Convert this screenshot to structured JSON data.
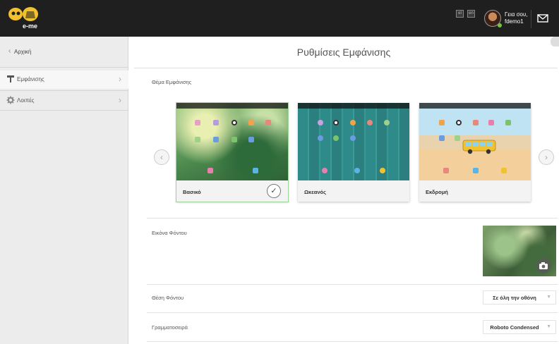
{
  "header": {
    "logo_text": "e-me",
    "greeting_line1": "Γεια σου,",
    "greeting_line2": "fdemo1",
    "square_icons": [
      "el",
      "en"
    ]
  },
  "sidebar": {
    "back_label": "Αρχική",
    "items": [
      {
        "label": "Εμφάνισης",
        "icon": "paint-roller-icon",
        "active": true
      },
      {
        "label": "Λοιπές",
        "icon": "gear-icon",
        "active": false
      }
    ]
  },
  "main": {
    "title": "Ρυθμίσεις Εμφάνισης",
    "theme_section_label": "Θέμα Εμφάνισης",
    "themes": [
      {
        "name": "Βασικό",
        "selected": true
      },
      {
        "name": "Ωκεανός",
        "selected": false
      },
      {
        "name": "Εκδρομή",
        "selected": false
      }
    ],
    "background_image_label": "Εικόνα Φόντου",
    "background_position_label": "Θέση Φόντου",
    "background_position_value": "Σε όλη την οθόνη",
    "font_label": "Γραμματοσειρά",
    "font_value": "Roboto Condensed"
  },
  "colors": {
    "topbar": "#1f1f1f",
    "sidebar": "#ececec",
    "accent_yellow": "#f2c12e",
    "selected_outline": "#9ed39a"
  }
}
